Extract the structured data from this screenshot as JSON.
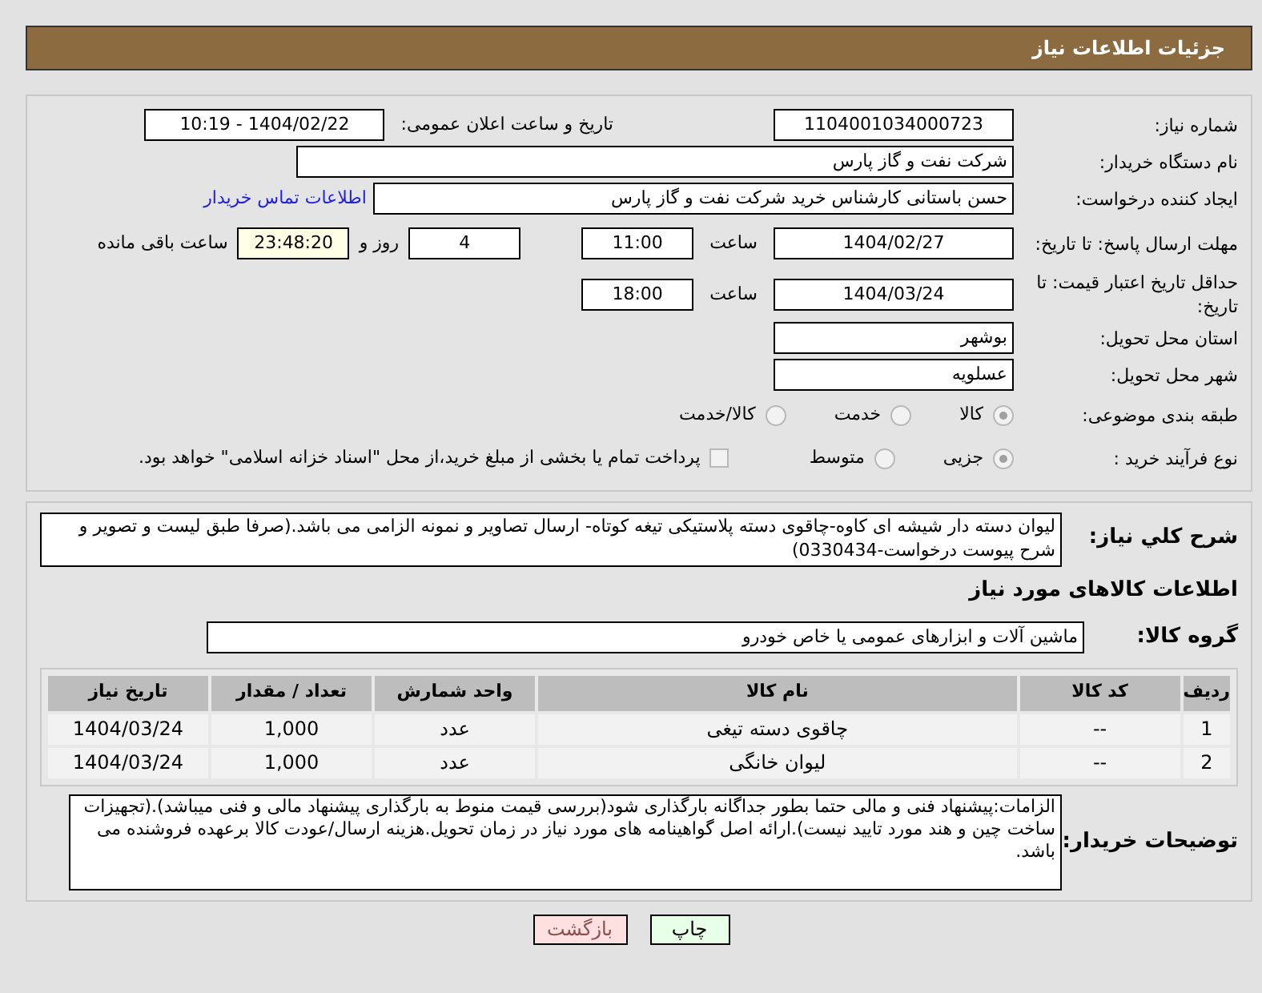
{
  "header": {
    "title": "جزئیات اطلاعات نیاز"
  },
  "need_number": {
    "label": "شماره نیاز:",
    "value": "1104001034000723"
  },
  "announce": {
    "label": "تاریخ و ساعت اعلان عمومی:",
    "value": "1404/02/22 - 10:19"
  },
  "buyer_org": {
    "label": "نام دستگاه خریدار:",
    "value": "شرکت نفت و گاز پارس"
  },
  "requester": {
    "label": "ایجاد کننده درخواست:",
    "value": "حسن باستانی کارشناس خرید شرکت نفت و گاز پارس",
    "link": "اطلاعات تماس خریدار"
  },
  "deadline": {
    "label": "مهلت ارسال پاسخ: تا تاریخ:",
    "date": "1404/02/27",
    "time_label": "ساعت",
    "time": "11:00",
    "days": "4",
    "days_label": "روز و",
    "remaining": "23:48:20",
    "remaining_label": "ساعت باقی مانده"
  },
  "price_validity": {
    "label": "حداقل تاریخ اعتبار قیمت: تا تاریخ:",
    "date": "1404/03/24",
    "time_label": "ساعت",
    "time": "18:00"
  },
  "province": {
    "label": "استان محل تحویل:",
    "value": "بوشهر"
  },
  "city": {
    "label": "شهر محل تحویل:",
    "value": "عسلویه"
  },
  "category": {
    "label": "طبقه بندی موضوعی:",
    "options": [
      {
        "label": "کالا",
        "selected": true
      },
      {
        "label": "خدمت",
        "selected": false
      },
      {
        "label": "کالا/خدمت",
        "selected": false
      }
    ]
  },
  "purchase_type": {
    "label": "نوع فرآیند خرید :",
    "options": [
      {
        "label": "جزیی",
        "selected": true
      },
      {
        "label": "متوسط",
        "selected": false
      }
    ],
    "treasury": {
      "label": "پرداخت تمام یا بخشی از مبلغ خرید،از محل \"اسناد خزانه اسلامی\" خواهد بود.",
      "checked": false
    }
  },
  "description": {
    "label": "شرح کلي نیاز:",
    "value": "لیوان دسته دار شیشه ای کاوه-چاقوی دسته پلاستیکی تیغه کوتاه- ارسال تصاویر و نمونه الزامی می باشد.(صرفا طبق لیست و تصویر و شرح پیوست درخواست-0330434)"
  },
  "goods_heading": "اطلاعات کالاهای مورد نیاز",
  "goods_group": {
    "label": "گروه کالا:",
    "value": "ماشین آلات و ابزارهای عمومی یا خاص خودرو"
  },
  "table": {
    "columns": [
      "ردیف",
      "کد کالا",
      "نام کالا",
      "واحد شمارش",
      "تعداد / مقدار",
      "تاریخ نیاز"
    ],
    "rows": [
      [
        "1",
        "--",
        "چاقوی دسته تیغی",
        "عدد",
        "1,000",
        "1404/03/24"
      ],
      [
        "2",
        "--",
        "لیوان خانگی",
        "عدد",
        "1,000",
        "1404/03/24"
      ]
    ]
  },
  "buyer_notes": {
    "label": "توضیحات خریدار:",
    "value": "الزامات:پیشنهاد فنی و مالی حتما  بطور جداگانه بارگذاری شود(بررسی قیمت منوط به بارگذاری پیشنهاد مالی و فنی میباشد).(تجهیزات ساخت چین و هند مورد تایید نیست).ارائه اصل گواهینامه های مورد نیاز در زمان تحویل.هزینه ارسال/عودت کالا برعهده فروشنده می باشد."
  },
  "buttons": [
    {
      "kind": "print",
      "label": "چاپ"
    },
    {
      "kind": "back",
      "label": "بازگشت"
    }
  ]
}
